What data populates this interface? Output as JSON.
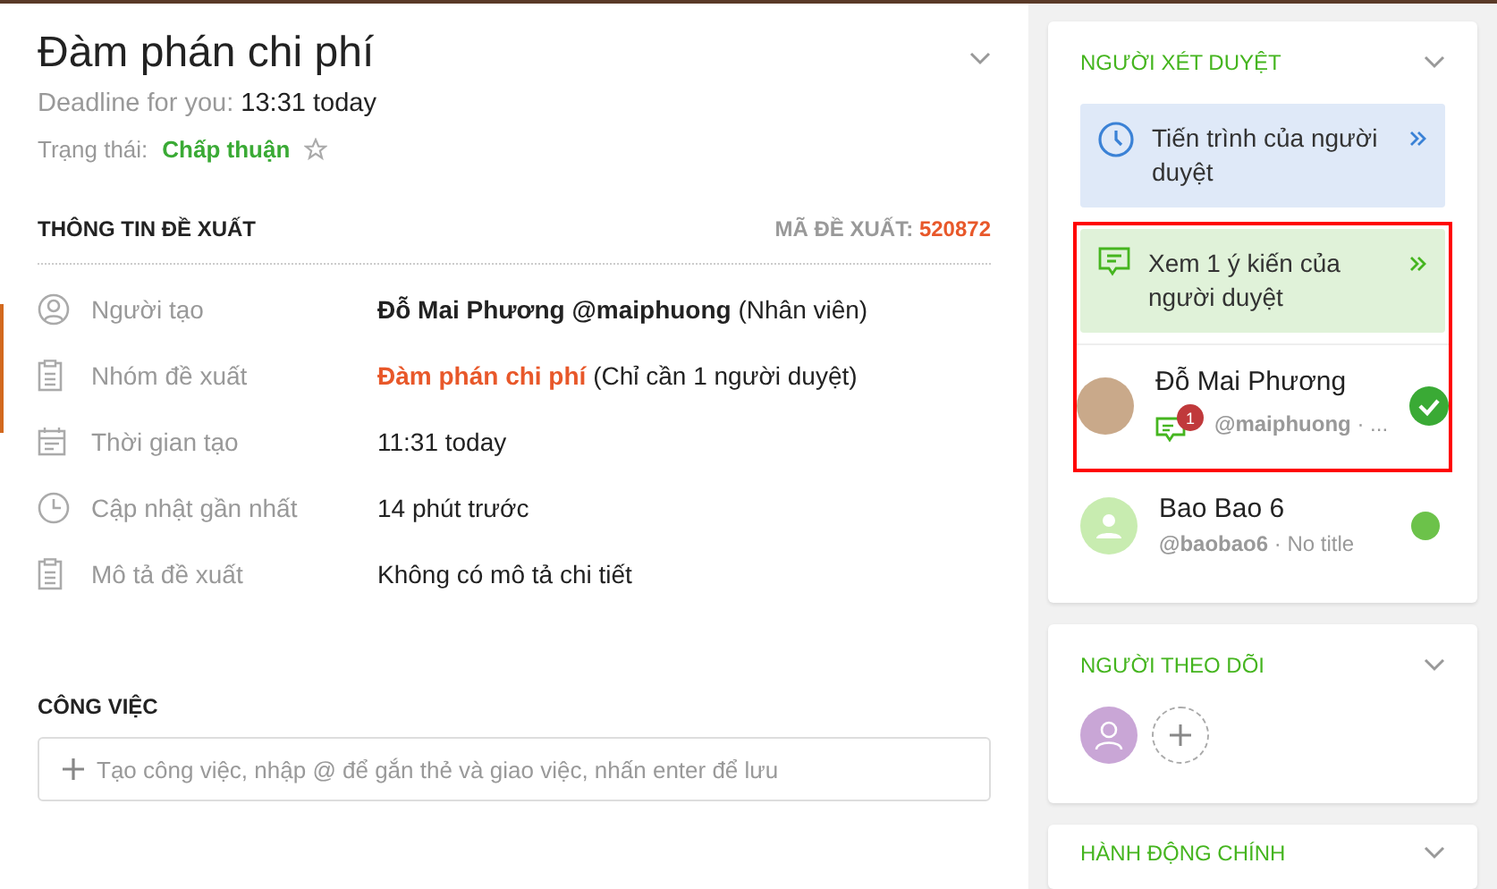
{
  "proposal": {
    "title": "Đàm phán chi phí",
    "deadline_label": "Deadline for you:",
    "deadline_value": "13:31 today",
    "status_label": "Trạng thái:",
    "status_value": "Chấp thuận",
    "starred": false
  },
  "info": {
    "heading": "THÔNG TIN ĐỀ XUẤT",
    "code_label": "MÃ ĐỀ XUẤT:",
    "code_value": "520872",
    "rows": [
      {
        "kind": "person",
        "label": "Người tạo",
        "value": "**Đỗ Mai Phương @maiphuong** (Nhân viên)"
      },
      {
        "kind": "clipboard",
        "label": "Nhóm đề xuất",
        "value": "Đàm phán chi phí",
        "note": "(Chỉ cần 1 người duyệt)"
      },
      {
        "kind": "calendar",
        "label": "Thời gian tạo",
        "value": "11:31 today"
      },
      {
        "kind": "clock",
        "label": "Cập nhật gần nhất",
        "value": "14 phút trước"
      },
      {
        "kind": "clipboard",
        "label": "Mô tả đề xuất",
        "value": "Không có mô tả chi tiết"
      }
    ]
  },
  "tasks": {
    "heading": "CÔNG VIỆC",
    "placeholder": "Tạo công việc, nhập @ để gắn thẻ và giao việc, nhấn enter để lưu"
  },
  "approvers": {
    "heading": "NGƯỜI XÉT DUYỆT",
    "expanded": true,
    "progress_link": "Tiến trình của người duyệt",
    "highlighted": true,
    "comments_link": "Xem 1 ý kiến của người duyệt",
    "people": [
      {
        "name": "Đỗ Mai Phương",
        "handle": "**@maiphuong** · ...",
        "photo": true,
        "comments": "1",
        "approved": true
      },
      {
        "name": "Bao Bao 6",
        "handle": "**@baobao6** · No title",
        "photo": false,
        "approved": false
      }
    ]
  },
  "followers": {
    "heading": "NGƯỜI THEO DÕI",
    "expanded": true
  },
  "main_actions": {
    "heading": "HÀNH ĐỘNG CHÍNH",
    "expanded": true
  }
}
